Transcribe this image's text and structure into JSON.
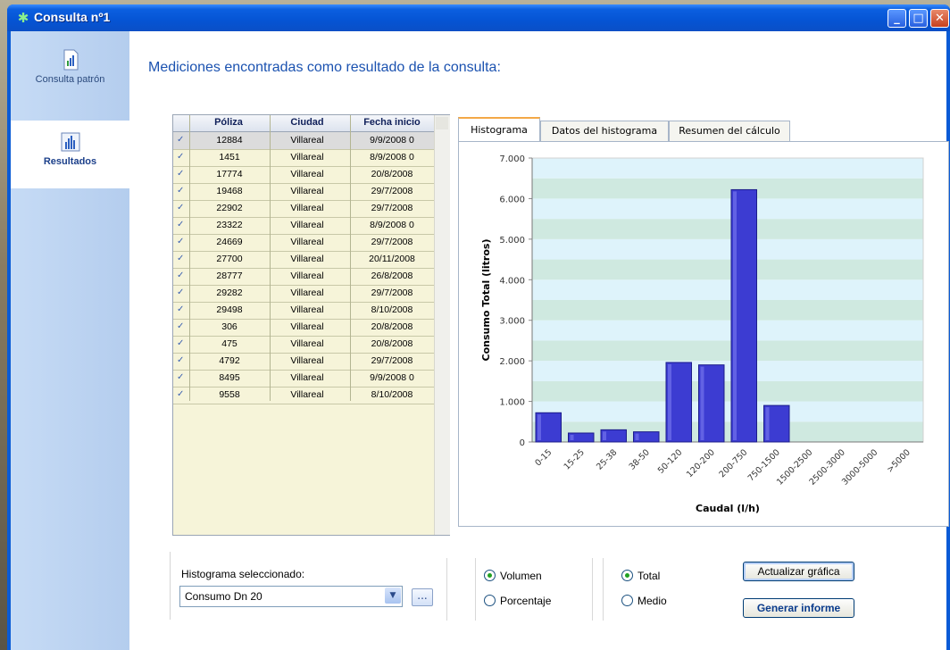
{
  "window": {
    "title": "Consulta nº1"
  },
  "sidebar": {
    "items": [
      {
        "label": "Consulta patrón",
        "icon": "chart-document-icon"
      },
      {
        "label": "Resultados",
        "icon": "bar-chart-icon"
      }
    ]
  },
  "heading": "Mediciones encontradas como resultado de la consulta:",
  "table": {
    "columns": [
      "Póliza",
      "Ciudad",
      "Fecha inicio"
    ],
    "rows": [
      [
        "12884",
        "Villareal",
        "9/9/2008 0"
      ],
      [
        "1451",
        "Villareal",
        "8/9/2008 0"
      ],
      [
        "17774",
        "Villareal",
        "20/8/2008"
      ],
      [
        "19468",
        "Villareal",
        "29/7/2008"
      ],
      [
        "22902",
        "Villareal",
        "29/7/2008"
      ],
      [
        "23322",
        "Villareal",
        "8/9/2008 0"
      ],
      [
        "24669",
        "Villareal",
        "29/7/2008"
      ],
      [
        "27700",
        "Villareal",
        "20/11/2008"
      ],
      [
        "28777",
        "Villareal",
        "26/8/2008"
      ],
      [
        "29282",
        "Villareal",
        "29/7/2008"
      ],
      [
        "29498",
        "Villareal",
        "8/10/2008"
      ],
      [
        "306",
        "Villareal",
        "20/8/2008"
      ],
      [
        "475",
        "Villareal",
        "20/8/2008"
      ],
      [
        "4792",
        "Villareal",
        "29/7/2008"
      ],
      [
        "8495",
        "Villareal",
        "9/9/2008 0"
      ],
      [
        "9558",
        "Villareal",
        "8/10/2008"
      ]
    ],
    "checked": true
  },
  "tabs": [
    "Histograma",
    "Datos del histograma",
    "Resumen del cálculo"
  ],
  "chart_data": {
    "type": "bar",
    "categories": [
      "0-15",
      "15-25",
      "25-38",
      "38-50",
      "50-120",
      "120-200",
      "200-750",
      "750-1500",
      "1500-2500",
      "2500-3000",
      "3000-5000",
      ">5000"
    ],
    "values": [
      720,
      220,
      300,
      250,
      1960,
      1900,
      6220,
      900,
      0,
      0,
      0,
      0
    ],
    "xlabel": "Caudal (l/h)",
    "ylabel": "Consumo Total (litros)",
    "ylim": [
      0,
      7000
    ],
    "yticks": [
      "0",
      "1.000",
      "2.000",
      "3.000",
      "4.000",
      "5.000",
      "6.000",
      "7.000"
    ],
    "bar_color": "#3c3cd2",
    "band_colors": [
      "#cfe9e0",
      "#def3fb"
    ]
  },
  "controls": {
    "histogram_label": "Histograma seleccionado:",
    "histogram_value": "Consumo Dn 20",
    "dots_label": "...",
    "radio_volumen": "Volumen",
    "radio_porcentaje": "Porcentaje",
    "radio_total": "Total",
    "radio_medio": "Medio",
    "update_button": "Actualizar gráfica",
    "report_button": "Generar informe"
  }
}
